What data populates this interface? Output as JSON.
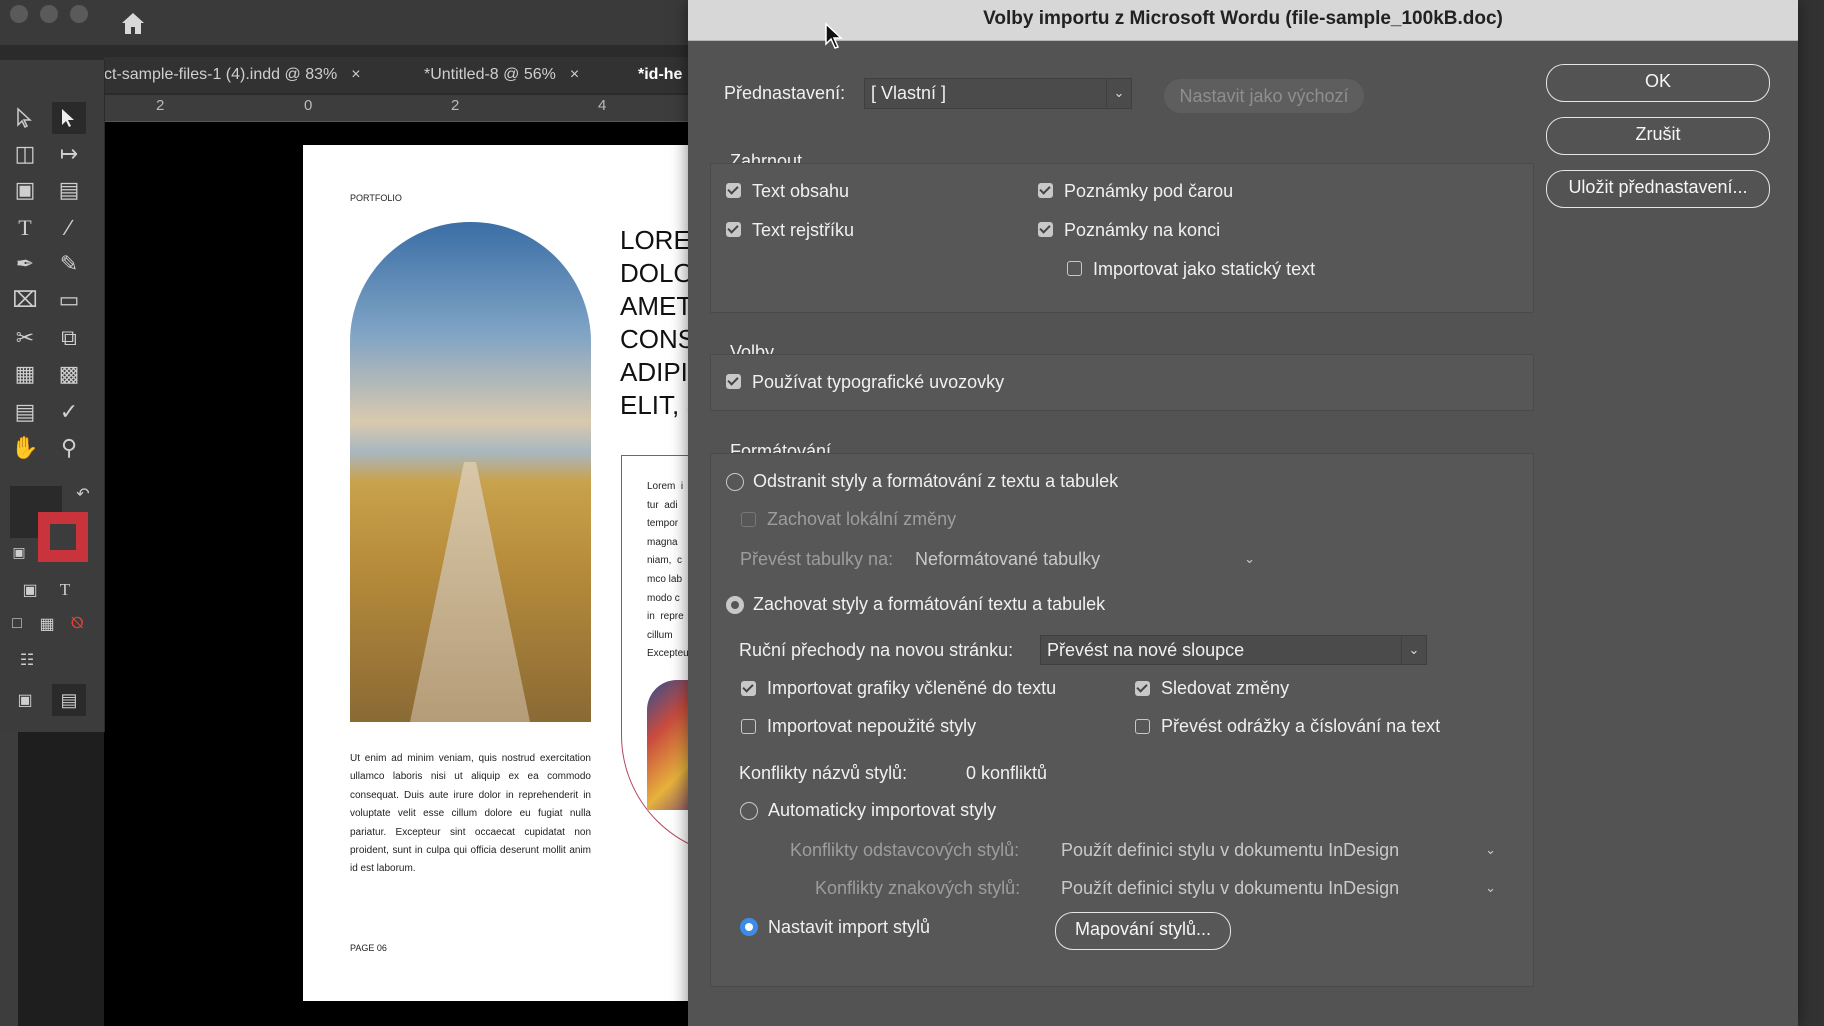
{
  "background": {
    "doc_tabs": [
      {
        "label": "ct-sample-files-1 (4).indd @ 83%",
        "close": "×"
      },
      {
        "label": "*Untitled-8 @ 56%",
        "close": "×"
      },
      {
        "label": "*id-he"
      }
    ],
    "ruler_numbers": [
      "2",
      "0",
      "2",
      "4"
    ],
    "page": {
      "header": "PORTFOLIO",
      "big_title": "LOREM\nDOLO\nAMET\nCONS\nADIPI\nELIT, S",
      "side_lines": "Lorem  i\ntur  adi\ntempor\nmagna\nniam,  c\nmco lab\nmodo c\nin  repre\ncillum\nExcepteu",
      "body": "Ut enim ad minim veniam, quis nostrud exercitation ullamco laboris nisi ut aliquip ex ea commodo consequat. Duis aute irure dolor in reprehenderit in voluptate velit esse cillum dolore eu fugiat nulla pariatur. Excepteur sint occaecat cupidatat non proident, sunt in culpa qui officia deserunt mollit anim id est laborum.",
      "footer": "PAGE 06"
    }
  },
  "dialog": {
    "title": "Volby importu z Microsoft Wordu (file-sample_100kB.doc)",
    "preset_label": "Přednastavení:",
    "preset_value": "[ Vlastní ]",
    "set_default_label": "Nastavit jako výchozí",
    "buttons": {
      "ok": "OK",
      "cancel": "Zrušit",
      "save_preset": "Uložit přednastavení..."
    },
    "include": {
      "title": "Zahrnout",
      "toc_text": "Text obsahu",
      "index_text": "Text rejstříku",
      "footnotes": "Poznámky pod čarou",
      "endnotes": "Poznámky na konci",
      "static_text": "Importovat jako statický text"
    },
    "options": {
      "title": "Volby",
      "typographer_quotes": "Používat typografické uvozovky"
    },
    "formatting": {
      "title": "Formátování",
      "remove_styles": "Odstranit styly a formátování z textu a tabulek",
      "preserve_local": "Zachovat lokální změny",
      "convert_tables_label": "Převést tabulky na:",
      "convert_tables_value": "Neformátované tabulky",
      "preserve_styles": "Zachovat styly a formátování textu a tabulek",
      "page_breaks_label": "Ruční přechody na novou stránku:",
      "page_breaks_value": "Převést na nové sloupce",
      "inline_graphics": "Importovat grafiky včleněné do textu",
      "track_changes": "Sledovat změny",
      "unused_styles": "Importovat nepoužité styly",
      "bullets_to_text": "Převést odrážky a číslování na text",
      "style_conflicts_label": "Konflikty názvů stylů:",
      "style_conflicts_value": "0 konfliktů",
      "auto_import": "Automaticky importovat styly",
      "para_conflicts_label": "Konflikty odstavcových stylů:",
      "para_conflicts_value": "Použít definici stylu v dokumentu InDesign",
      "char_conflicts_label": "Konflikty znakových stylů:",
      "char_conflicts_value": "Použít definici stylu v dokumentu InDesign",
      "customize_import": "Nastavit import stylů",
      "style_mapping_button": "Mapování stylů..."
    }
  }
}
